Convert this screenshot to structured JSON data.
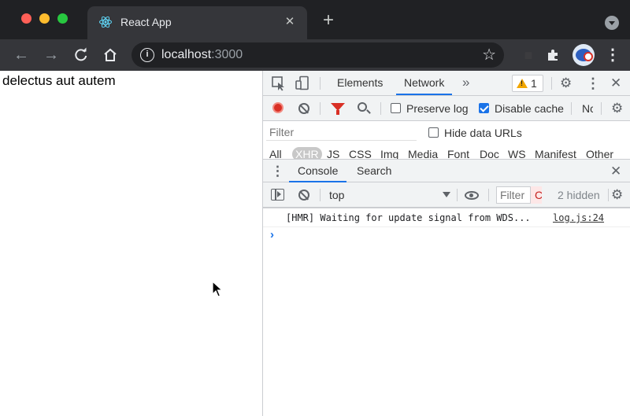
{
  "browser": {
    "tab": {
      "title": "React App",
      "favicon": "react-logo-icon"
    },
    "address": {
      "host": "localhost",
      "port": ":3000"
    },
    "icons": {
      "back": "arrow-left-icon",
      "forward": "arrow-right-icon",
      "reload": "reload-icon",
      "home": "home-icon",
      "bookmark": "star-icon",
      "extensions": "puzzle-icon",
      "menu": "kebab-icon"
    }
  },
  "page": {
    "text": "delectus aut autem"
  },
  "devtools": {
    "main_tabs": [
      "Elements",
      "Network"
    ],
    "more_tabs_glyph": "»",
    "issues_count": "1",
    "network": {
      "preserve_log": "Preserve log",
      "preserve_log_checked": false,
      "disable_cache": "Disable cache",
      "disable_cache_checked": true,
      "throttle_peek": "Nc",
      "filter_placeholder": "Filter",
      "hide_data_urls": "Hide data URLs",
      "hide_data_urls_checked": false,
      "types": [
        "All",
        "XHR",
        "JS",
        "CSS",
        "Img",
        "Media",
        "Font",
        "Doc",
        "WS",
        "Manifest",
        "Other"
      ],
      "active_type": "XHR"
    },
    "drawer": {
      "tabs": [
        "Console",
        "Search"
      ],
      "active_tab": "Console",
      "context": "top",
      "filter_placeholder": "Filter",
      "levels_peek": "C",
      "hidden": "2 hidden",
      "log": [
        {
          "message": "[HMR] Waiting for update signal from WDS...",
          "source": "log.js:24"
        }
      ],
      "prompt": "›"
    }
  },
  "colors": {
    "titlebar": "#202124",
    "toolbar": "#35363a",
    "accent": "#1a73e8",
    "record": "#d93025",
    "warning": "#f2a600"
  }
}
